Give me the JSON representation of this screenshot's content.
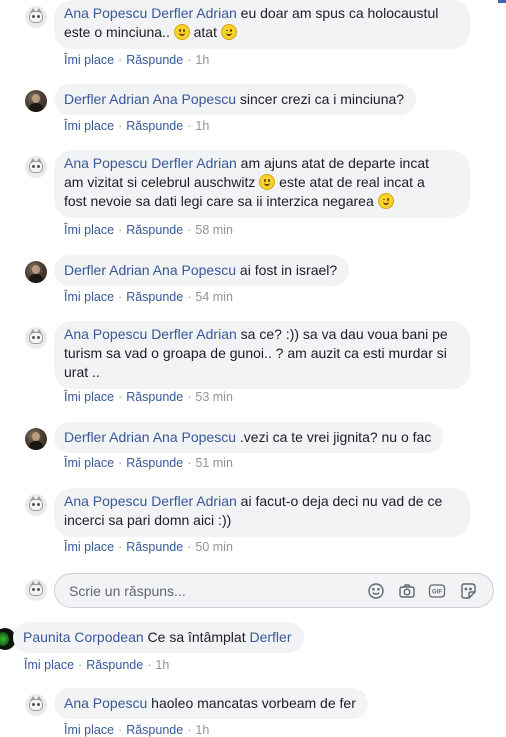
{
  "comments": [
    {
      "avatar": "cat-avatar",
      "author": "Ana Popescu",
      "tag": "Derfler Adrian",
      "line1": " eu doar am spus ca holocaustul",
      "line2a": "este o minciuna.. ",
      "line2b": " atat ",
      "like": "Îmi place",
      "reply": "Răspunde",
      "time": "1h"
    },
    {
      "avatar": "dark-avatar",
      "author": "Derfler Adrian",
      "tag": "Ana Popescu",
      "text": " sincer crezi ca i minciuna?",
      "like": "Îmi place",
      "reply": "Răspunde",
      "time": "1h"
    },
    {
      "avatar": "cat-avatar",
      "author": "Ana Popescu",
      "tag": "Derfler Adrian",
      "line1": " am ajuns atat de departe incat",
      "line2a": "am vizitat si celebrul auschwitz ",
      "line2b": " este atat de real incat a",
      "line3": "fost nevoie sa dati legi care sa ii interzica negarea ",
      "like": "Îmi place",
      "reply": "Răspunde",
      "time": "58 min"
    },
    {
      "avatar": "dark-avatar",
      "author": "Derfler Adrian",
      "tag": "Ana Popescu",
      "text": " ai fost in israel?",
      "like": "Îmi place",
      "reply": "Răspunde",
      "time": "54 min"
    },
    {
      "avatar": "cat-avatar",
      "author": "Ana Popescu",
      "tag": "Derfler Adrian",
      "line1": " sa ce? :)) sa va dau voua bani pe",
      "line2": "turism sa vad o groapa de gunoi.. ? am auzit ca esti murdar si",
      "line3": "urat ..",
      "like": "Îmi place",
      "reply": "Răspunde",
      "time": "53 min"
    },
    {
      "avatar": "dark-avatar",
      "author": "Derfler Adrian",
      "tag": "Ana Popescu",
      "text": " .vezi ca te vrei jignita? nu o fac",
      "like": "Îmi place",
      "reply": "Răspunde",
      "time": "51 min"
    },
    {
      "avatar": "cat-avatar",
      "author": "Ana Popescu",
      "tag": "Derfler Adrian",
      "line1": " ai facut-o deja deci nu vad de ce",
      "line2": "incerci sa pari domn aici :))",
      "like": "Îmi place",
      "reply": "Răspunde",
      "time": "50 min"
    },
    {
      "avatar": "green-avatar",
      "author": "Paunita Corpodean",
      "text": " Ce sa întâmplat ",
      "tag": "Derfler",
      "like": "Îmi place",
      "reply": "Răspunde",
      "time": "1h"
    },
    {
      "avatar": "cat-avatar",
      "author": "Ana Popescu",
      "text": " haoleo mancatas vorbeam de fer",
      "like": "Îmi place",
      "reply": "Răspunde",
      "time": "1h"
    }
  ],
  "reply_box": {
    "placeholder": "Scrie un răspuns...",
    "icons": [
      "emoji-icon",
      "camera-icon",
      "gif-icon",
      "sticker-icon"
    ]
  },
  "colors": {
    "link": "#385898",
    "bubble": "#f2f3f5",
    "meta": "#90949c",
    "accent": "#4267b2"
  }
}
